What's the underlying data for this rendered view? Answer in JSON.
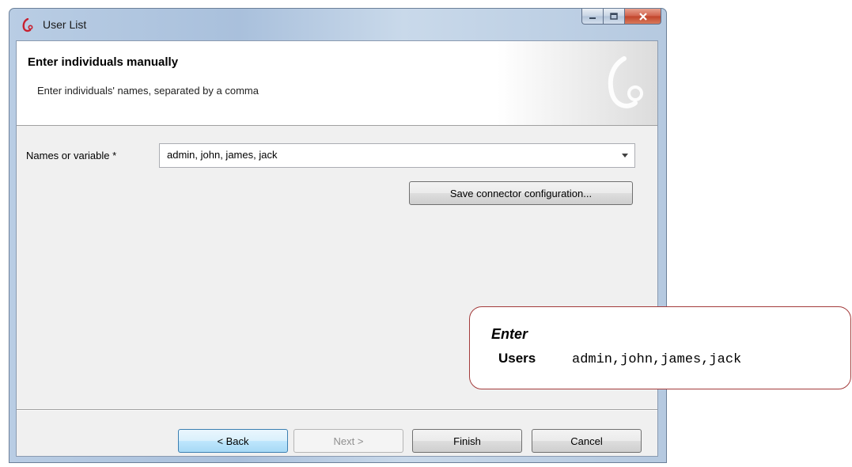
{
  "window": {
    "title": "User List",
    "icon": "bonita-logo-icon",
    "buttons": [
      "minimize-icon",
      "maximize-icon",
      "close-icon"
    ]
  },
  "header": {
    "title": "Enter individuals manually",
    "subtitle": "Enter individuals' names, separated by a comma"
  },
  "form": {
    "names_label": "Names or variable *",
    "names_value": "admin, john, james, jack",
    "save_button": "Save connector configuration..."
  },
  "footer": {
    "back": "< Back",
    "next": "Next >",
    "finish": "Finish",
    "cancel": "Cancel"
  },
  "callout": {
    "title": "Enter",
    "key": "Users",
    "value": "admin,john,james,jack"
  },
  "colors": {
    "callout_border": "#a33b3b",
    "close_button": "#c1432a",
    "default_button_border": "#3c7fb1"
  }
}
